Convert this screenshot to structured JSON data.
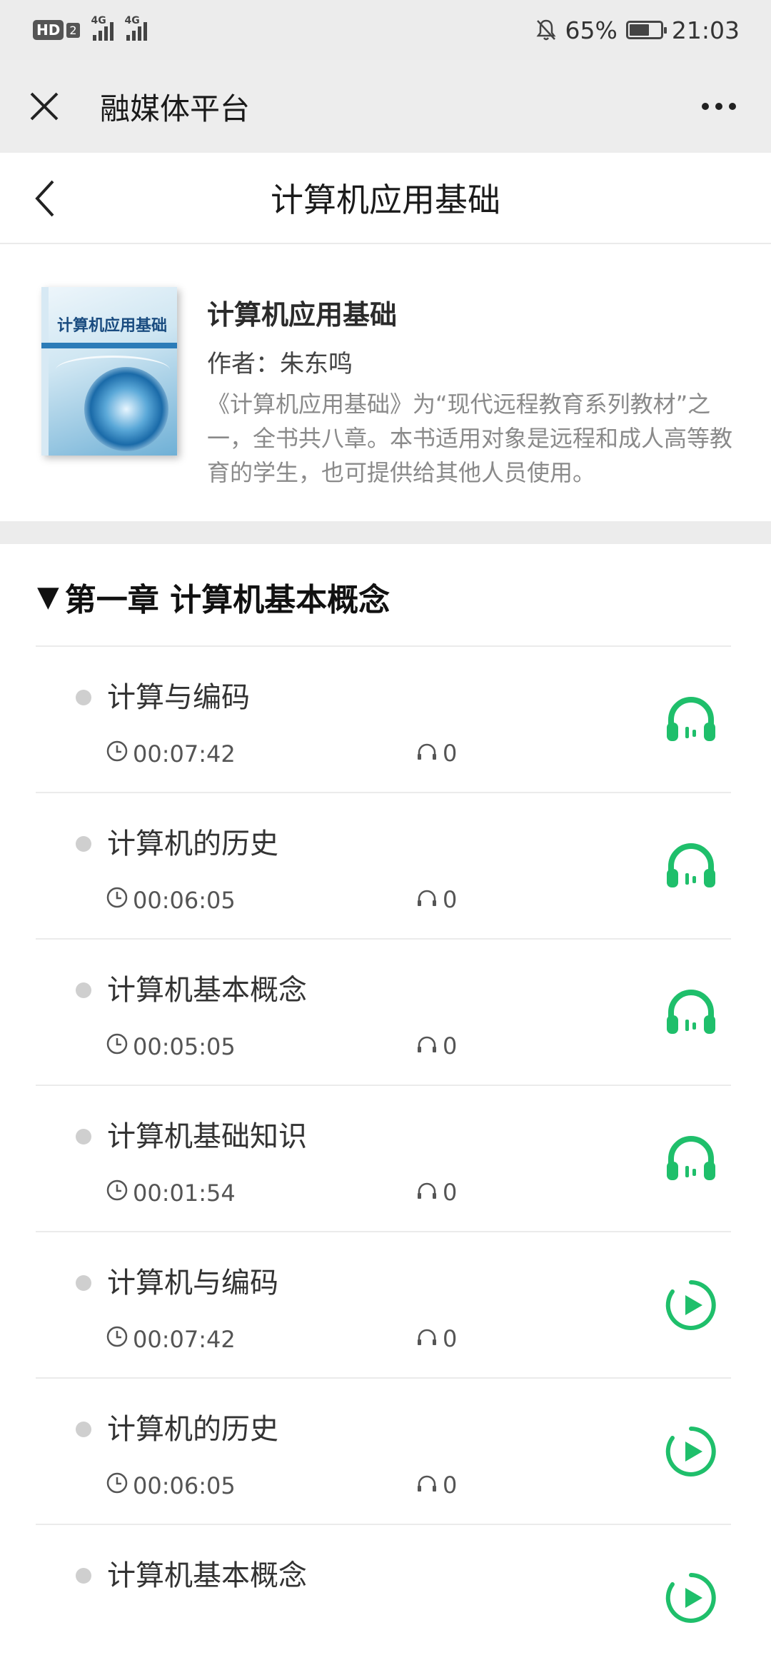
{
  "status_bar": {
    "hd": "HD",
    "hd_sub": "2",
    "net1": "4G",
    "net2": "4G",
    "battery": "65%",
    "time": "21:03",
    "battery_level": 0.65
  },
  "app_bar": {
    "title": "融媒体平台"
  },
  "header": {
    "title": "计算机应用基础"
  },
  "book": {
    "name": "计算机应用基础",
    "author": "作者：朱东鸣",
    "description": "《计算机应用基础》为“现代远程教育系列教材”之一，全书共八章。本书适用对象是远程和成人高等教育的学生，也可提供给其他人员使用。",
    "cover_title": "计算机应用基础"
  },
  "chapter": {
    "marker": "▼",
    "title": "第一章 计算机基本概念",
    "items": [
      {
        "title": "计算与编码",
        "duration": "00:07:42",
        "plays": "0",
        "action_icon": "headphones-icon"
      },
      {
        "title": "计算机的历史",
        "duration": "00:06:05",
        "plays": "0",
        "action_icon": "headphones-icon"
      },
      {
        "title": "计算机基本概念",
        "duration": "00:05:05",
        "plays": "0",
        "action_icon": "headphones-icon"
      },
      {
        "title": "计算机基础知识",
        "duration": "00:01:54",
        "plays": "0",
        "action_icon": "headphones-icon"
      },
      {
        "title": "计算机与编码",
        "duration": "00:07:42",
        "plays": "0",
        "action_icon": "play-circle-icon"
      },
      {
        "title": "计算机的历史",
        "duration": "00:06:05",
        "plays": "0",
        "action_icon": "play-circle-icon"
      },
      {
        "title": "计算机基本概念",
        "duration": "",
        "plays": "",
        "action_icon": "play-circle-icon"
      }
    ]
  },
  "colors": {
    "accent_green": "#1fbf6b",
    "bar_gray": "#ededed"
  }
}
